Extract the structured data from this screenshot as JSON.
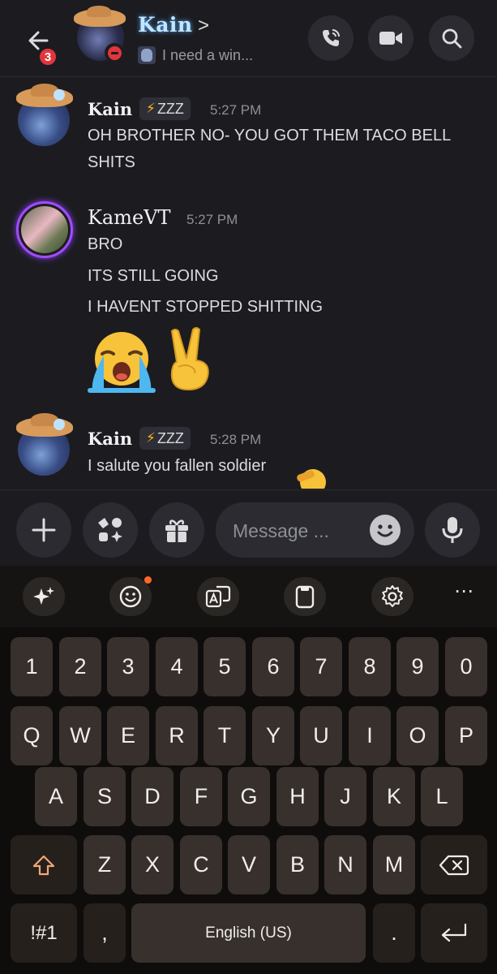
{
  "header": {
    "back_badge": "3",
    "contact_name": "Kain",
    "chevron": ">",
    "status_text": "I need a win..."
  },
  "messages": [
    {
      "author": "Kain",
      "tag": "ZZZ",
      "time": "5:27 PM",
      "lines": [
        "OH BROTHER NO- YOU GOT THEM TACO BELL",
        "SHITS"
      ]
    },
    {
      "author": "KameVT",
      "time": "5:27 PM",
      "lines": [
        "BRO",
        "ITS STILL GOING",
        "I HAVENT STOPPED SHITTING"
      ],
      "emojis": [
        "😭",
        "✌️"
      ]
    },
    {
      "author": "Kain",
      "tag": "ZZZ",
      "time": "5:28 PM",
      "lines": [
        "I salute you fallen soldier"
      ]
    }
  ],
  "composer": {
    "placeholder": "Message ..."
  },
  "keyboard": {
    "more_label": "⋯",
    "number_row": [
      "1",
      "2",
      "3",
      "4",
      "5",
      "6",
      "7",
      "8",
      "9",
      "0"
    ],
    "row1": [
      "Q",
      "W",
      "E",
      "R",
      "T",
      "Y",
      "U",
      "I",
      "O",
      "P"
    ],
    "row2": [
      "A",
      "S",
      "D",
      "F",
      "G",
      "H",
      "J",
      "K",
      "L"
    ],
    "row3": [
      "Z",
      "X",
      "C",
      "V",
      "B",
      "N",
      "M"
    ],
    "symbols_key": "!#1",
    "comma_key": ",",
    "space_label": "English (US)",
    "period_key": "."
  },
  "colors": {
    "background": "#1c1c20",
    "dnd_red": "#e2353d",
    "kame_ring": "#a14cff",
    "key_bg": "#38302c"
  }
}
